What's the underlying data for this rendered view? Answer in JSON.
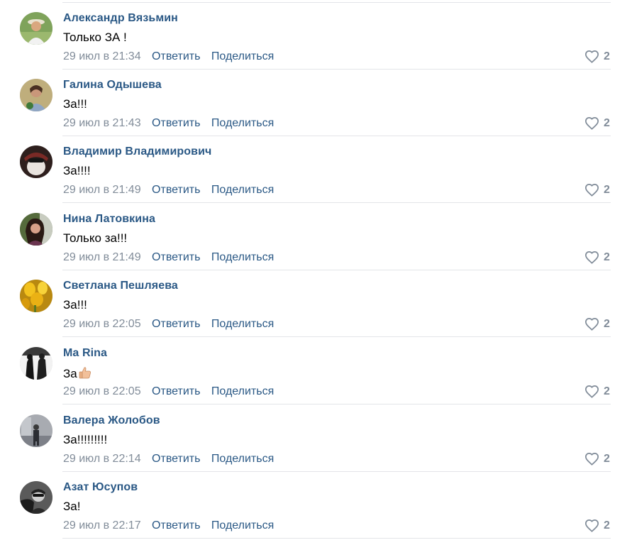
{
  "comments": [
    {
      "author": "Александр Вязьмин",
      "text": "Только ЗА !",
      "date": "29 июл в 21:34",
      "reply": "Ответить",
      "share": "Поделиться",
      "likes": "2",
      "avatar_color": "#6f8a4c"
    },
    {
      "author": "Галина Одышева",
      "text": "За!!!",
      "date": "29 июл в 21:43",
      "reply": "Ответить",
      "share": "Поделиться",
      "likes": "2",
      "avatar_color": "#a89a6a"
    },
    {
      "author": "Владимир Владимирович",
      "text": "За!!!!",
      "date": "29 июл в 21:49",
      "reply": "Ответить",
      "share": "Поделиться",
      "likes": "2",
      "avatar_color": "#3a2a28"
    },
    {
      "author": "Нина Латовкина",
      "text": "Только за!!!",
      "date": "29 июл в 21:49",
      "reply": "Ответить",
      "share": "Поделиться",
      "likes": "2",
      "avatar_color": "#4a5a3a"
    },
    {
      "author": "Светлана Пешляева",
      "text": "За!!!",
      "date": "29 июл в 22:05",
      "reply": "Ответить",
      "share": "Поделиться",
      "likes": "2",
      "avatar_color": "#d9a514"
    },
    {
      "author": "Ma Rina",
      "text": "За",
      "date": "29 июл в 22:05",
      "reply": "Ответить",
      "share": "Поделиться",
      "likes": "2",
      "avatar_color": "#2b2b2b"
    },
    {
      "author": "Валера Жолобов",
      "text": "За!!!!!!!!!",
      "date": "29 июл в 22:14",
      "reply": "Ответить",
      "share": "Поделиться",
      "likes": "2",
      "avatar_color": "#8d9098"
    },
    {
      "author": "Азат Юсупов",
      "text": "За!",
      "date": "29 июл в 22:17",
      "reply": "Ответить",
      "share": "Поделиться",
      "likes": "2",
      "avatar_color": "#3c3c3c"
    }
  ],
  "icons": {
    "like": "heart-outline-icon",
    "emoji": "thumbs-up-icon"
  },
  "colors": {
    "author": "#2a5885",
    "meta": "#818c99",
    "divider": "#e3e4e8"
  }
}
